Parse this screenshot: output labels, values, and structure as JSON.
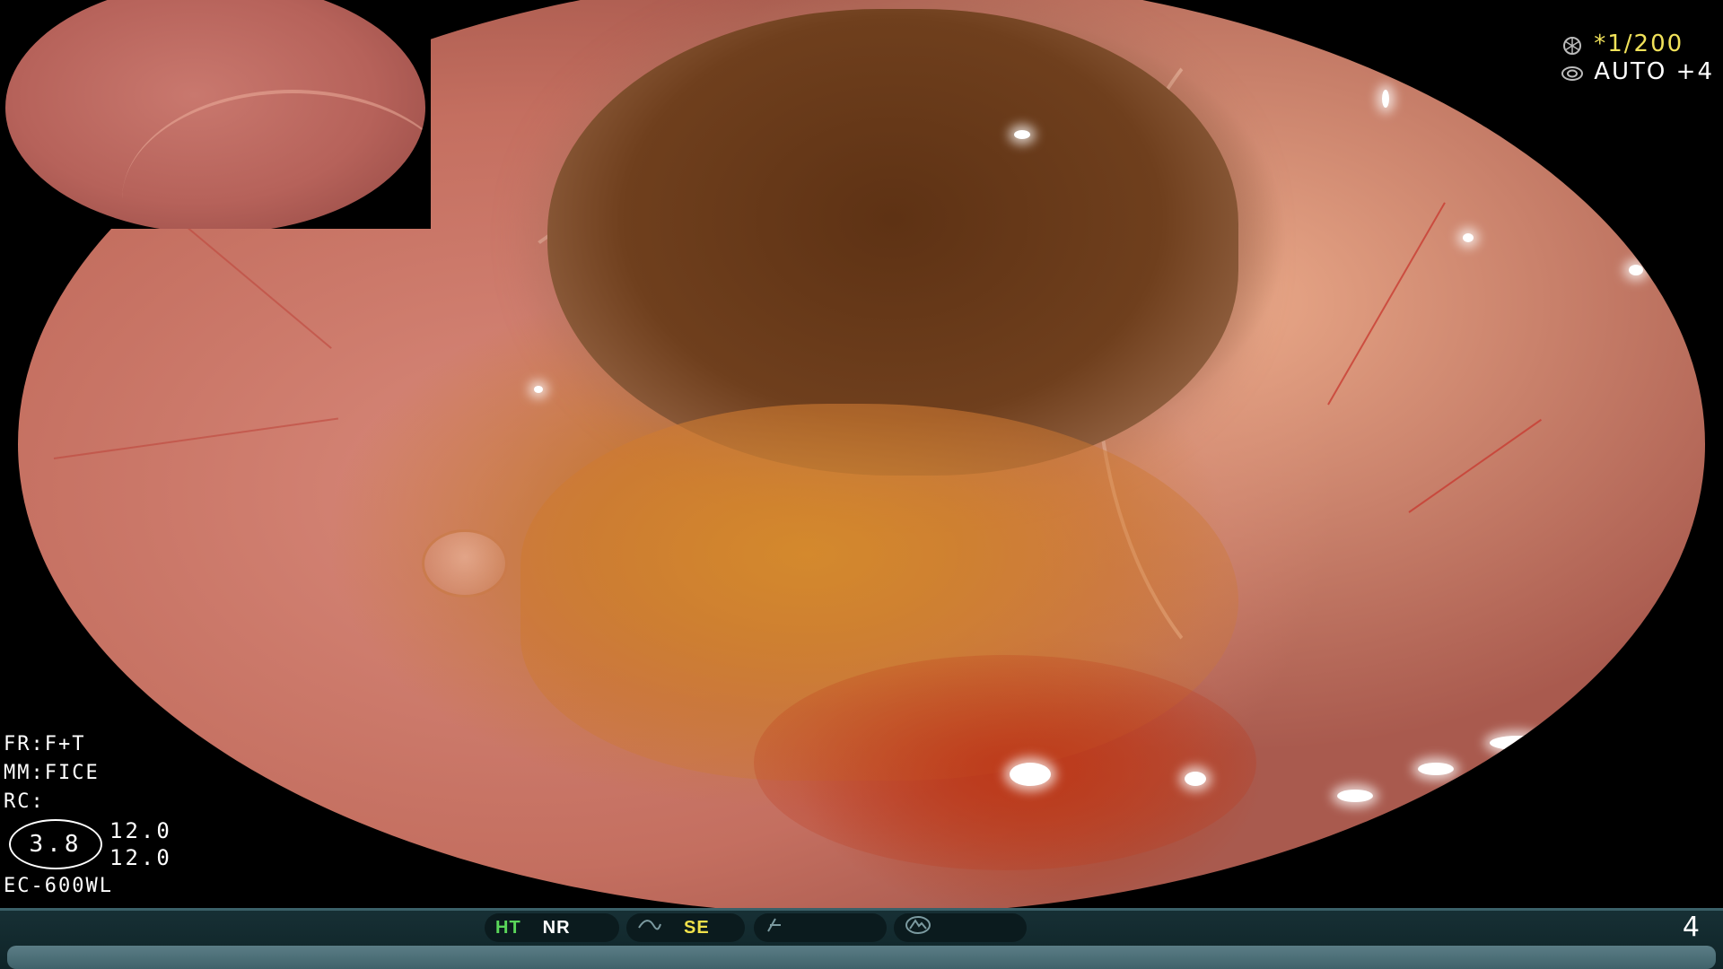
{
  "header": {
    "shutter_value": "*1/200",
    "iris_value": "AUTO +4",
    "shutter_icon": "aperture-icon",
    "iris_icon": "iris-icon"
  },
  "info": {
    "fr": "FR:F+T",
    "mm": "MM:FICE",
    "rc": "RC:",
    "zoom": "3.8",
    "value1": "12.0",
    "value2": "12.0",
    "model": "EC-600WL"
  },
  "status_bar": {
    "ht": "HT",
    "nr": "NR",
    "se": "SE",
    "page": "4",
    "pill2_icon": "tilde-curve-icon",
    "pill3_icon": "slash-icon",
    "pill4_icon": "mountain-circle-icon"
  },
  "colors": {
    "accent_yellow": "#f0e14a",
    "accent_green": "#5ad65a",
    "bar_background": "#173035"
  }
}
